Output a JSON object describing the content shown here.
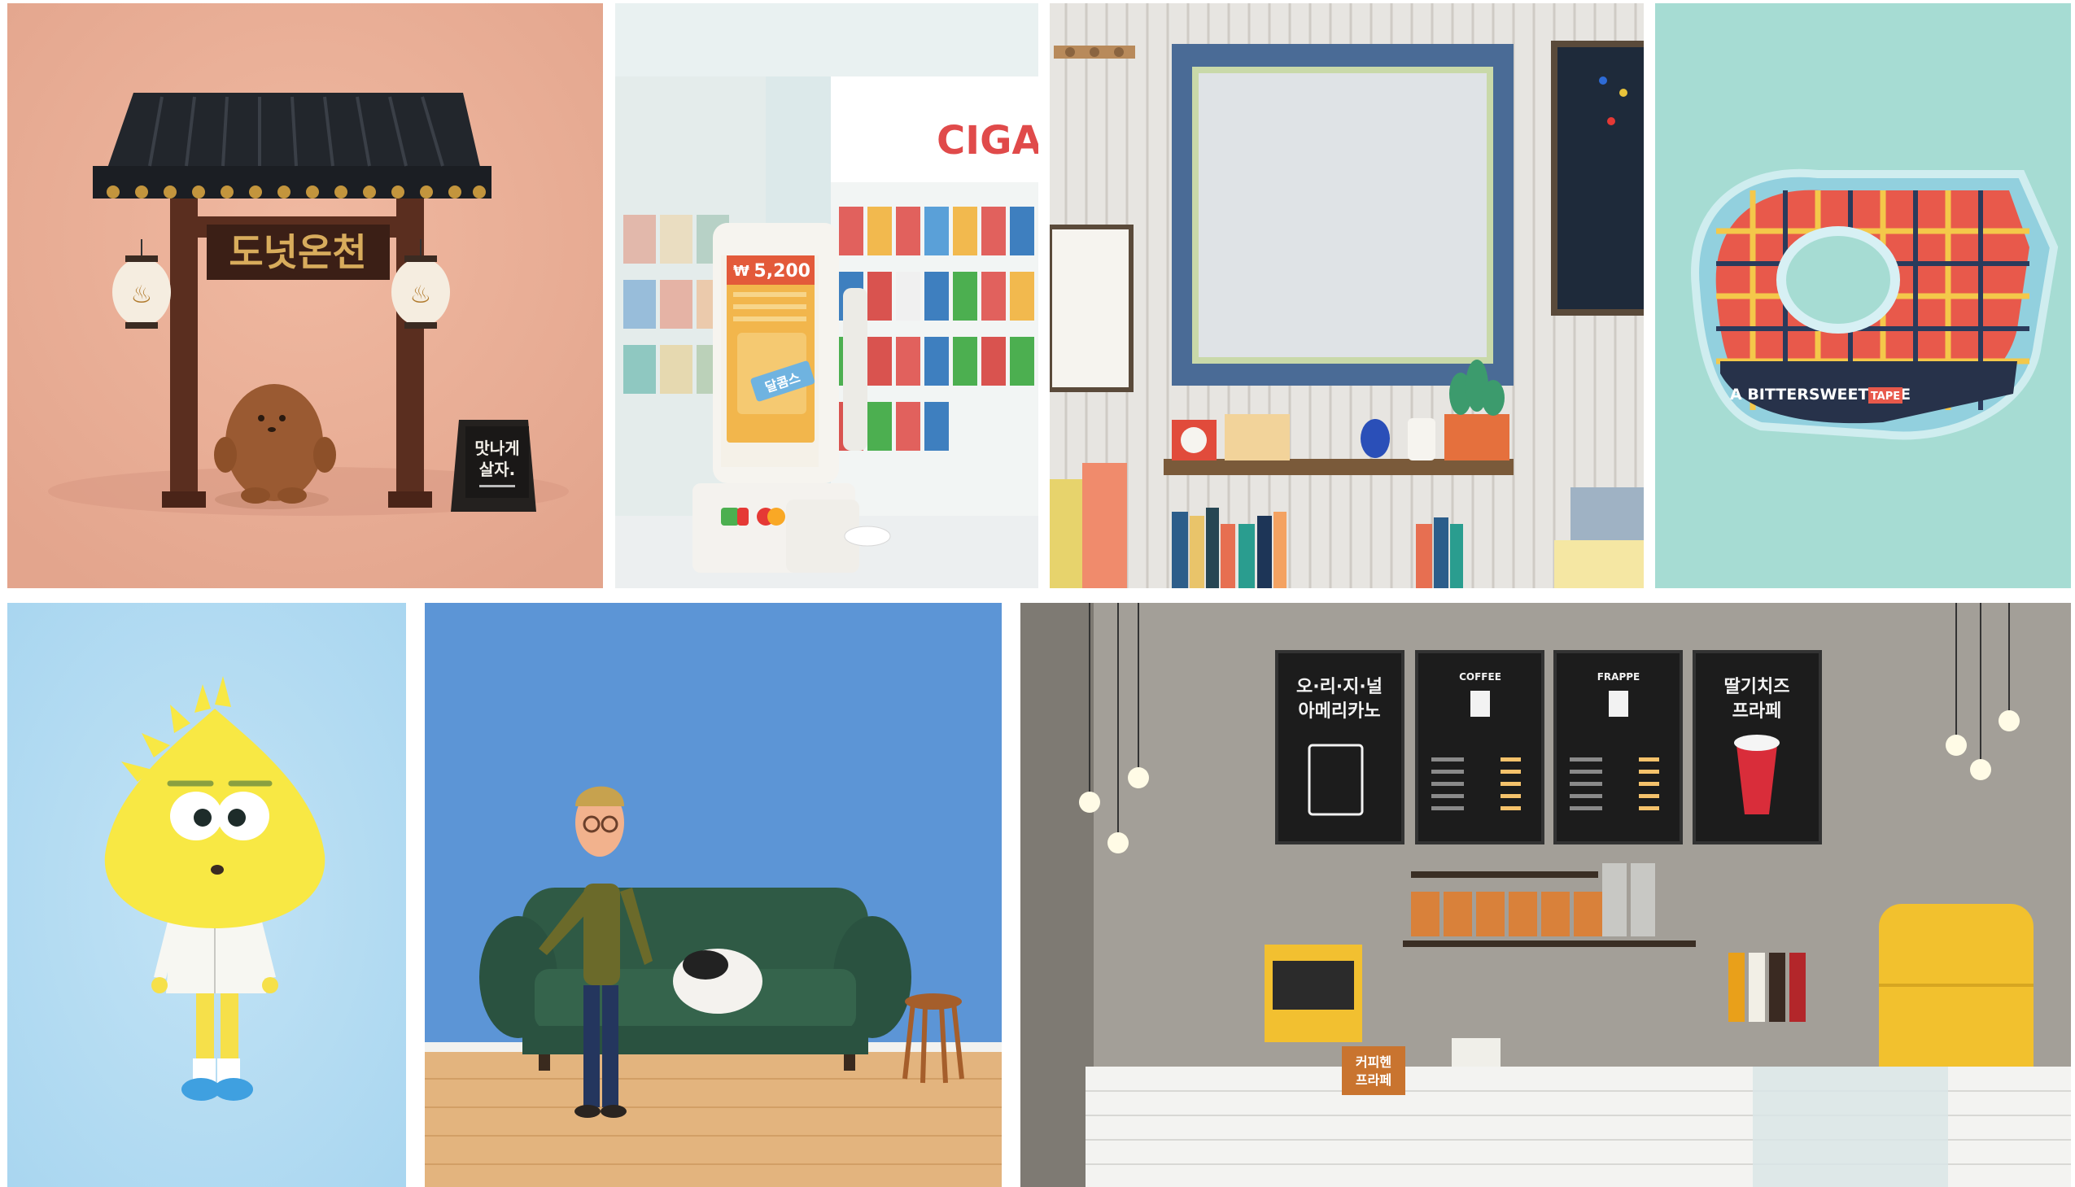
{
  "gallery": {
    "tiles": [
      {
        "id": "tile-bathhouse-gate",
        "signboard_text": "도넛온천",
        "sign_text_line1": "맛나게",
        "sign_text_line2": "살자."
      },
      {
        "id": "tile-convenience-store-pos",
        "store_sign": "CIGA",
        "currency": "₩",
        "amount": "5,200",
        "popup_text": "달콤스"
      },
      {
        "id": "tile-room-shelf"
      },
      {
        "id": "tile-tape-dispenser",
        "tape_label": "A BITTERSWEET LIFE",
        "tape_badge": "TAPE"
      },
      {
        "id": "tile-yellow-character"
      },
      {
        "id": "tile-man-on-sofa"
      },
      {
        "id": "tile-cafe-counter",
        "menu_board_1_line1": "오·리·지·널",
        "menu_board_1_line2": "아메리카노",
        "menu_board_2_title": "COFFEE",
        "menu_board_3_title": "FRAPPE",
        "menu_board_4_line1": "딸기치즈",
        "menu_board_4_line2": "프라페",
        "counter_sign_line1": "커피헨",
        "counter_sign_line2": "프라페"
      }
    ]
  }
}
